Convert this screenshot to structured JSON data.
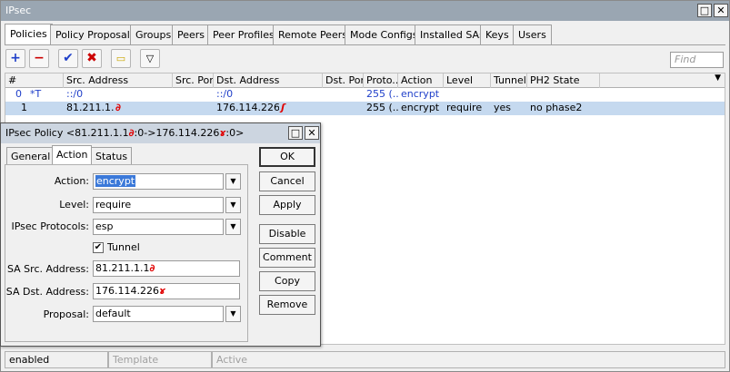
{
  "window": {
    "title": "IPsec"
  },
  "tabs": [
    "Policies",
    "Policy Proposals",
    "Groups",
    "Peers",
    "Peer Profiles",
    "Remote Peers",
    "Mode Configs",
    "Installed SAs",
    "Keys",
    "Users"
  ],
  "toolbar": {
    "find_placeholder": "Find"
  },
  "table": {
    "columns": [
      "#",
      "Src. Address",
      "Src. Port",
      "Dst. Address",
      "Dst. Port",
      "Proto...",
      "Action",
      "Level",
      "Tunnel",
      "PH2 State"
    ],
    "rows": [
      {
        "num": "0",
        "flag": "*T",
        "src": "::/0",
        "src_port": "",
        "dst": "::/0",
        "dst_port": "",
        "proto": "255 (...",
        "action": "encrypt",
        "level": "",
        "tunnel": "",
        "ph2": ""
      },
      {
        "num": "1",
        "flag": "",
        "src": "81.211.1.1",
        "src_port": "",
        "dst": "176.114.226.1",
        "dst_port": "",
        "proto": "255 (...",
        "action": "encrypt",
        "level": "require",
        "tunnel": "yes",
        "ph2": "no phase2"
      }
    ]
  },
  "statusbar": [
    "enabled",
    "Template",
    "Active"
  ],
  "dialog": {
    "title": "IPsec Policy <81.211.1.1",
    "title_mid": ":0->176.114.226",
    "title_end": ":0>",
    "tabs": [
      "General",
      "Action",
      "Status"
    ],
    "labels": {
      "action": "Action:",
      "level": "Level:",
      "protocols": "IPsec Protocols:",
      "tunnel": "Tunnel",
      "sa_src": "SA Src. Address:",
      "sa_dst": "SA Dst. Address:",
      "proposal": "Proposal:"
    },
    "values": {
      "action": "encrypt",
      "level": "require",
      "protocols": "esp",
      "sa_src": "81.211.1.1",
      "sa_dst": "176.114.226",
      "proposal": "default"
    },
    "buttons": [
      "OK",
      "Cancel",
      "Apply",
      "Disable",
      "Comment",
      "Copy",
      "Remove"
    ]
  },
  "colors": {
    "selection": "#c5d9ef",
    "highlight": "#3b79d9",
    "redact": "#e00000"
  }
}
